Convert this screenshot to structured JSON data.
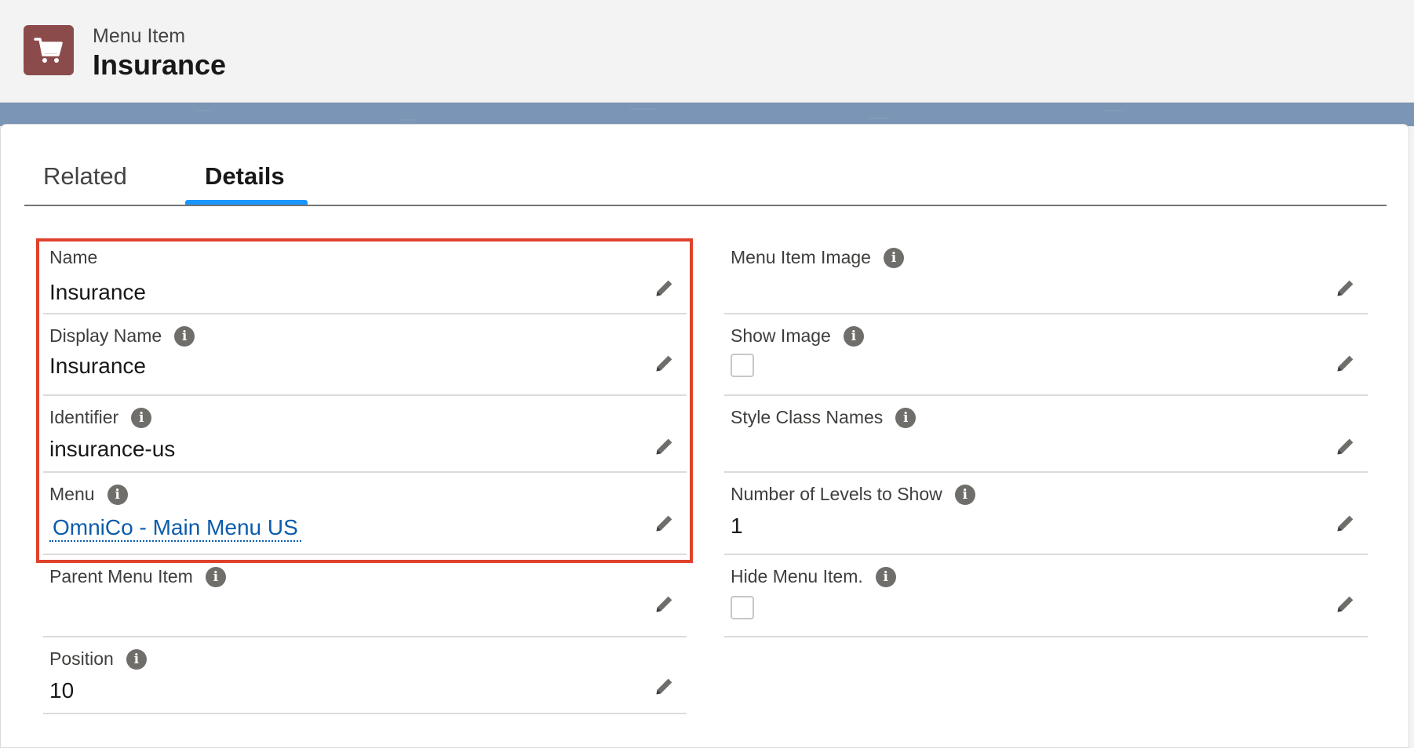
{
  "header": {
    "object_type": "Menu Item",
    "record_name": "Insurance",
    "icon": "cart-icon",
    "icon_color": "#8c4b4b"
  },
  "tabs": [
    {
      "label": "Related",
      "active": false
    },
    {
      "label": "Details",
      "active": true
    }
  ],
  "accent_color": "#1b96ff",
  "highlight_color": "#e0412b",
  "left_fields": [
    {
      "label": "Name",
      "value": "Insurance",
      "info": false
    },
    {
      "label": "Display Name",
      "value": "Insurance",
      "info": true
    },
    {
      "label": "Identifier",
      "value": "insurance-us",
      "info": true
    },
    {
      "label": "Menu",
      "value": "OmniCo - Main Menu US",
      "info": true,
      "link": true
    },
    {
      "label": "Parent Menu Item",
      "value": "",
      "info": true
    },
    {
      "label": "Position",
      "value": "10",
      "info": true
    }
  ],
  "right_fields": [
    {
      "label": "Menu Item Image",
      "value": "",
      "info": true
    },
    {
      "label": "Show Image",
      "value": "",
      "info": true,
      "checkbox": true,
      "checked": false
    },
    {
      "label": "Style Class Names",
      "value": "",
      "info": true
    },
    {
      "label": "Number of Levels to Show",
      "value": "1",
      "info": true
    },
    {
      "label": "Hide Menu Item.",
      "value": "",
      "info": true,
      "checkbox": true,
      "checked": false
    }
  ]
}
